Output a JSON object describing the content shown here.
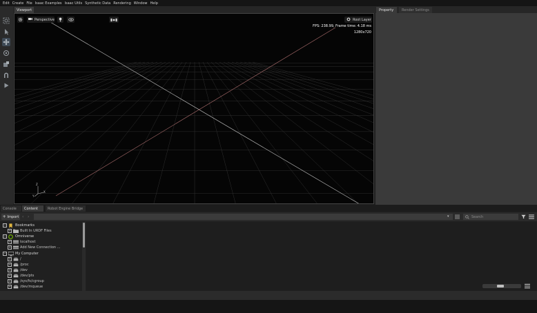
{
  "menu": [
    "Edit",
    "Create",
    "File",
    "Isaac Examples",
    "Isaac Utils",
    "Synthetic Data",
    "Rendering",
    "Window",
    "Help"
  ],
  "viewport": {
    "tab_label": "Viewport",
    "camera_label": "Perspective",
    "layer_label": "Root Layer",
    "fps_text": "FPS: 238.99, Frame time: 4.18 ms",
    "resolution_text": "1280x720",
    "axis_x": "X",
    "axis_y": "Y",
    "axis_z": "Z",
    "grid_color": "#3a3a3a",
    "axis_x_color": "#c06060",
    "axis_z_color": "#6060c0"
  },
  "right_panel": {
    "tabs": [
      "Property",
      "Render Settings"
    ]
  },
  "bottom_tabs": [
    "Console",
    "Content",
    "Robot Engine Bridge"
  ],
  "content": {
    "import_label": "Import",
    "search_placeholder": "Search"
  },
  "tree": [
    {
      "label": "Bookmarks",
      "level": 0,
      "toggle": "−",
      "icon": "bookmark-icon"
    },
    {
      "label": "Built In URDF Files",
      "level": 1,
      "toggle": "+",
      "icon": "folder-icon"
    },
    {
      "label": "Omniverse",
      "level": 0,
      "toggle": "−",
      "icon": "omniverse-icon"
    },
    {
      "label": "localhost",
      "level": 1,
      "toggle": "+",
      "icon": "server-icon"
    },
    {
      "label": "Add New Connection ...",
      "level": 1,
      "toggle": "+",
      "icon": "server-icon"
    },
    {
      "label": "My Computer",
      "level": 0,
      "toggle": "−",
      "icon": "computer-icon"
    },
    {
      "label": "/",
      "level": 1,
      "toggle": "+",
      "icon": "drive-icon"
    },
    {
      "label": "/proc",
      "level": 1,
      "toggle": "+",
      "icon": "drive-icon"
    },
    {
      "label": "/dev",
      "level": 1,
      "toggle": "+",
      "icon": "drive-icon"
    },
    {
      "label": "/dev/pts",
      "level": 1,
      "toggle": "+",
      "icon": "drive-icon"
    },
    {
      "label": "/sys/fs/cgroup",
      "level": 1,
      "toggle": "+",
      "icon": "drive-icon"
    },
    {
      "label": "/dev/mqueue",
      "level": 1,
      "toggle": "+",
      "icon": "drive-icon"
    }
  ]
}
